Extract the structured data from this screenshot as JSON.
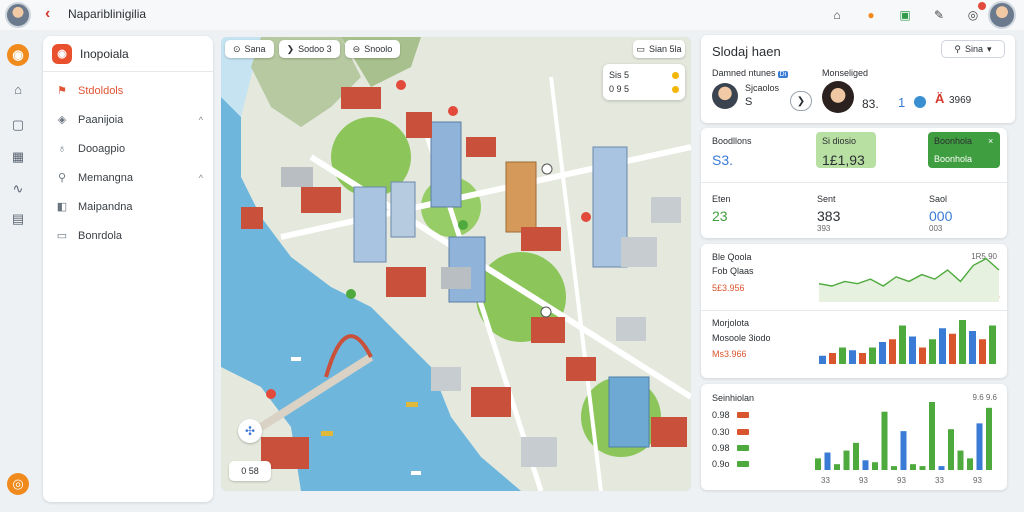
{
  "topbar": {
    "title": "Napariblinigilia",
    "icons": [
      "home-icon",
      "flame-icon",
      "calendar-icon",
      "share-icon",
      "notifications-icon"
    ]
  },
  "sidebar": {
    "title": "Inopoiala",
    "items": [
      {
        "label": "Stdoldols",
        "icon": "map-pin-icon",
        "active": true
      },
      {
        "label": "Paanijoia",
        "icon": "location-icon",
        "expandable": true
      },
      {
        "label": "Dooagpio",
        "icon": "pin-icon"
      },
      {
        "label": "Memangna",
        "icon": "search-icon",
        "expandable": true
      },
      {
        "label": "Maipandna",
        "icon": "layers-icon"
      },
      {
        "label": "Bonrdola",
        "icon": "file-icon"
      }
    ]
  },
  "map": {
    "tabs": [
      "Sana",
      "Sodoo 3",
      "Snoolo"
    ],
    "search_label": "Sian 5la",
    "legend": [
      {
        "label": "Sis 5",
        "color": "#f2b705"
      },
      {
        "label": "0 9 5",
        "color": "#f2b705"
      }
    ],
    "scale": "0 58",
    "colors": {
      "water": "#6fb6dd",
      "land": "#e3e7dc",
      "park": "#8cc65b",
      "roof": "#c9503a"
    }
  },
  "panel1": {
    "title": "Slodaj haen",
    "search": "Sina",
    "label1": "Damned ntunes",
    "label1_badge": "Di",
    "label2": "Monseliged",
    "person1_name": "Sjcaolos",
    "person1_value": "S",
    "person2_value": "83.",
    "value3": "1",
    "value4": "Ä",
    "value4b": "3969"
  },
  "kpis": [
    {
      "label": "Boodllons",
      "value": "S3.",
      "sub": "",
      "color": "#3a7bd5"
    },
    {
      "label": "Si diosio",
      "value": "1£1,93",
      "sub": "",
      "color": "#2b2f33",
      "box": "#b9e0a3"
    },
    {
      "label": "Boonhola",
      "value": "",
      "sub": "",
      "color": "#ffffff",
      "box": "#3f9e3f"
    },
    {
      "label": "Eten",
      "value": "23",
      "sub": "",
      "color": "#3f9e3f"
    },
    {
      "label": "Sent",
      "value": "383",
      "sub": "393",
      "color": "#2b2f33"
    },
    {
      "label": "Saol",
      "value": "000",
      "sub": "003",
      "color": "#3a7bd5"
    }
  ],
  "panel3": {
    "title": "Ble Qoola",
    "subtitle": "Fob Qlaas",
    "value": "5£3.956",
    "right_label": "1R5 90",
    "title2": "Morjolota",
    "subtitle2": "Mosoole 3iodo",
    "value2": "Ms3.966"
  },
  "panel4": {
    "title": "Seinhiolan",
    "right_label": "9.6 9.6",
    "legend": [
      {
        "label": "0.98",
        "color": "#d9552e"
      },
      {
        "label": "0.30",
        "color": "#d9552e"
      },
      {
        "label": "0.98",
        "color": "#4faa3e"
      },
      {
        "label": "0.9o",
        "color": "#4faa3e"
      }
    ],
    "x_labels": [
      "33",
      "93",
      "93",
      "33",
      "93"
    ]
  },
  "chart_data": [
    {
      "type": "line",
      "series": [
        {
          "values": [
            30,
            28,
            31,
            30,
            32,
            29,
            34,
            31,
            35,
            30,
            36,
            33,
            30,
            38,
            28
          ]
        },
        {
          "values": [
            34,
            33,
            35,
            34,
            36,
            33,
            37,
            35,
            38,
            36,
            40,
            35,
            42,
            45,
            40
          ]
        }
      ]
    },
    {
      "type": "bar",
      "series": [
        {
          "values": [
            3,
            4,
            6,
            5,
            4,
            6,
            8,
            9,
            14,
            10,
            6,
            9,
            13,
            11,
            16,
            12,
            9,
            14
          ]
        }
      ]
    },
    {
      "type": "bar",
      "series": [
        {
          "values": [
            6,
            9,
            3,
            10,
            14,
            5,
            4,
            30,
            2,
            20,
            3,
            2,
            35,
            2,
            21,
            10,
            6,
            24,
            32
          ]
        }
      ]
    }
  ]
}
